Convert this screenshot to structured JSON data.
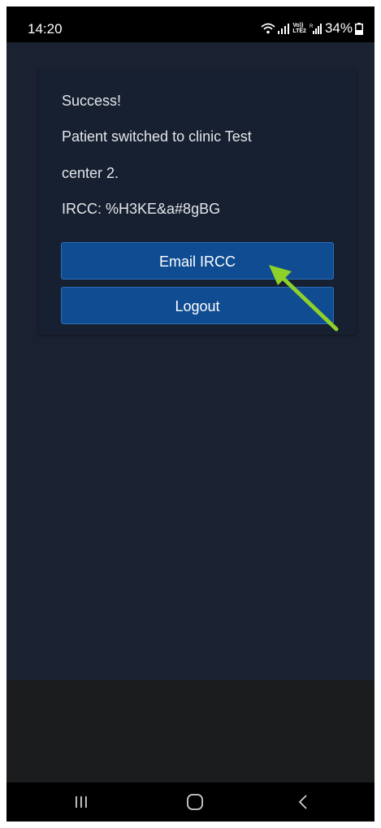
{
  "status_bar": {
    "time": "14:20",
    "network_top": "Vo))",
    "network_bottom": "LTE2",
    "battery": "34%"
  },
  "message": {
    "line1": "Success!",
    "line2": "Patient switched to clinic Test",
    "line3": "center 2.",
    "line4": "IRCC: %H3KE&a#8gBG"
  },
  "buttons": {
    "email": "Email IRCC",
    "logout": "Logout"
  },
  "colors": {
    "background": "#1a2130",
    "card": "#172030",
    "button": "#0f4c91",
    "annotation_arrow": "#8ed12b"
  },
  "icons": [
    "wifi-icon",
    "signal-icon",
    "battery-icon",
    "recent-apps-icon",
    "home-icon",
    "back-icon",
    "annotation-arrow"
  ]
}
